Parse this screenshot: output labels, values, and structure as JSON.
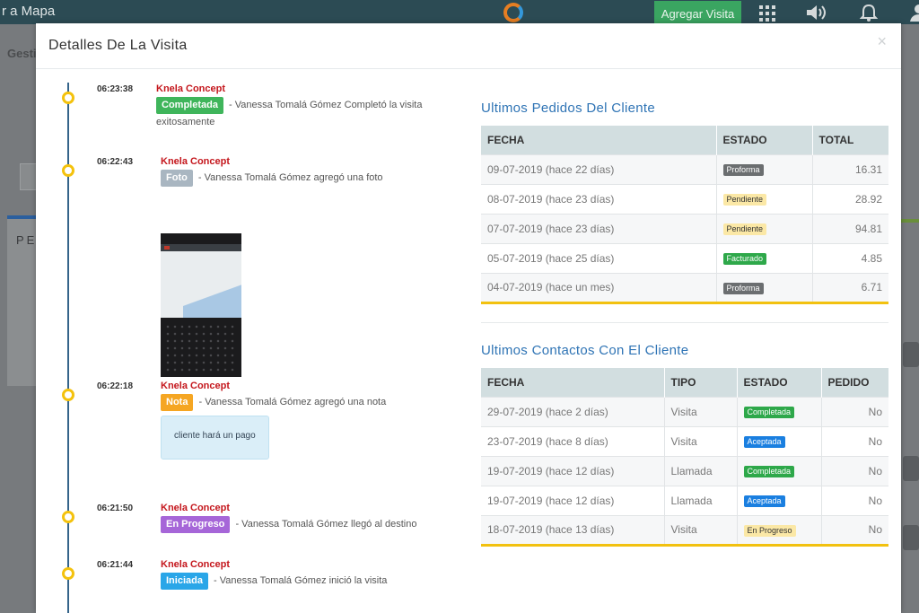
{
  "app": {
    "title": "r a Mapa",
    "add_visit_label": "Agregar Visita",
    "nav_fragment": "Gesti",
    "card_fragment": "PE"
  },
  "modal": {
    "title": "Detalles De La Visita",
    "close_label": "×"
  },
  "timeline": [
    {
      "time": "06:23:38",
      "author": "Knela Concept",
      "badge": "Completada",
      "badge_color": "#3fb55b",
      "text": " - Vanessa Tomalá Gómez Completó la visita exitosamente"
    },
    {
      "time": "06:22:43",
      "author": "Knela Concept",
      "badge": "Foto",
      "badge_color": "#a9b6c1",
      "text": " - Vanessa Tomalá Gómez agregó una foto"
    },
    {
      "time": "06:22:18",
      "author": "Knela Concept",
      "badge": "Nota",
      "badge_color": "#f5a623",
      "text": " - Vanessa Tomalá Gómez agregó una nota",
      "note": "cliente hará un pago"
    },
    {
      "time": "06:21:50",
      "author": "Knela Concept",
      "badge": "En Progreso",
      "badge_color": "#a666d8",
      "text": " - Vanessa Tomalá Gómez llegó al destino"
    },
    {
      "time": "06:21:44",
      "author": "Knela Concept",
      "badge": "Iniciada",
      "badge_color": "#2aa6e8",
      "text": " - Vanessa Tomalá Gómez inició la visita"
    }
  ],
  "orders": {
    "title": "Ultimos Pedidos Del Cliente",
    "headers": [
      "FECHA",
      "ESTADO",
      "TOTAL"
    ],
    "rows": [
      {
        "date": "09-07-2019 (hace 22 días)",
        "status": "Proforma",
        "status_bg": "#6b6e70",
        "status_fg": "#ffffff",
        "total": "16.31"
      },
      {
        "date": "08-07-2019 (hace 23 días)",
        "status": "Pendiente",
        "status_bg": "#fbe8a6",
        "status_fg": "#333333",
        "total": "28.92"
      },
      {
        "date": "07-07-2019 (hace 23 días)",
        "status": "Pendiente",
        "status_bg": "#fbe8a6",
        "status_fg": "#333333",
        "total": "94.81"
      },
      {
        "date": "05-07-2019 (hace 25 días)",
        "status": "Facturado",
        "status_bg": "#2ea84a",
        "status_fg": "#ffffff",
        "total": "4.85"
      },
      {
        "date": "04-07-2019 (hace un mes)",
        "status": "Proforma",
        "status_bg": "#6b6e70",
        "status_fg": "#ffffff",
        "total": "6.71"
      }
    ]
  },
  "contacts": {
    "title": "Ultimos Contactos Con El Cliente",
    "headers": [
      "FECHA",
      "TIPO",
      "ESTADO",
      "PEDIDO"
    ],
    "rows": [
      {
        "date": "29-07-2019 (hace 2 días)",
        "type": "Visita",
        "status": "Completada",
        "status_bg": "#2ea84a",
        "status_fg": "#ffffff",
        "order": "No"
      },
      {
        "date": "23-07-2019 (hace 8 días)",
        "type": "Visita",
        "status": "Aceptada",
        "status_bg": "#1a7fe0",
        "status_fg": "#ffffff",
        "order": "No"
      },
      {
        "date": "19-07-2019 (hace 12 días)",
        "type": "Llamada",
        "status": "Completada",
        "status_bg": "#2ea84a",
        "status_fg": "#ffffff",
        "order": "No"
      },
      {
        "date": "19-07-2019 (hace 12 días)",
        "type": "Llamada",
        "status": "Aceptada",
        "status_bg": "#1a7fe0",
        "status_fg": "#ffffff",
        "order": "No"
      },
      {
        "date": "18-07-2019 (hace 13 días)",
        "type": "Visita",
        "status": "En Progreso",
        "status_bg": "#fbe8a6",
        "status_fg": "#333333",
        "order": "No"
      }
    ]
  },
  "colors": {
    "accent_blue": "#2f74b5",
    "timeline_line": "#35648a",
    "timeline_dot": "#f4c20d",
    "author_red": "#c4161c"
  }
}
